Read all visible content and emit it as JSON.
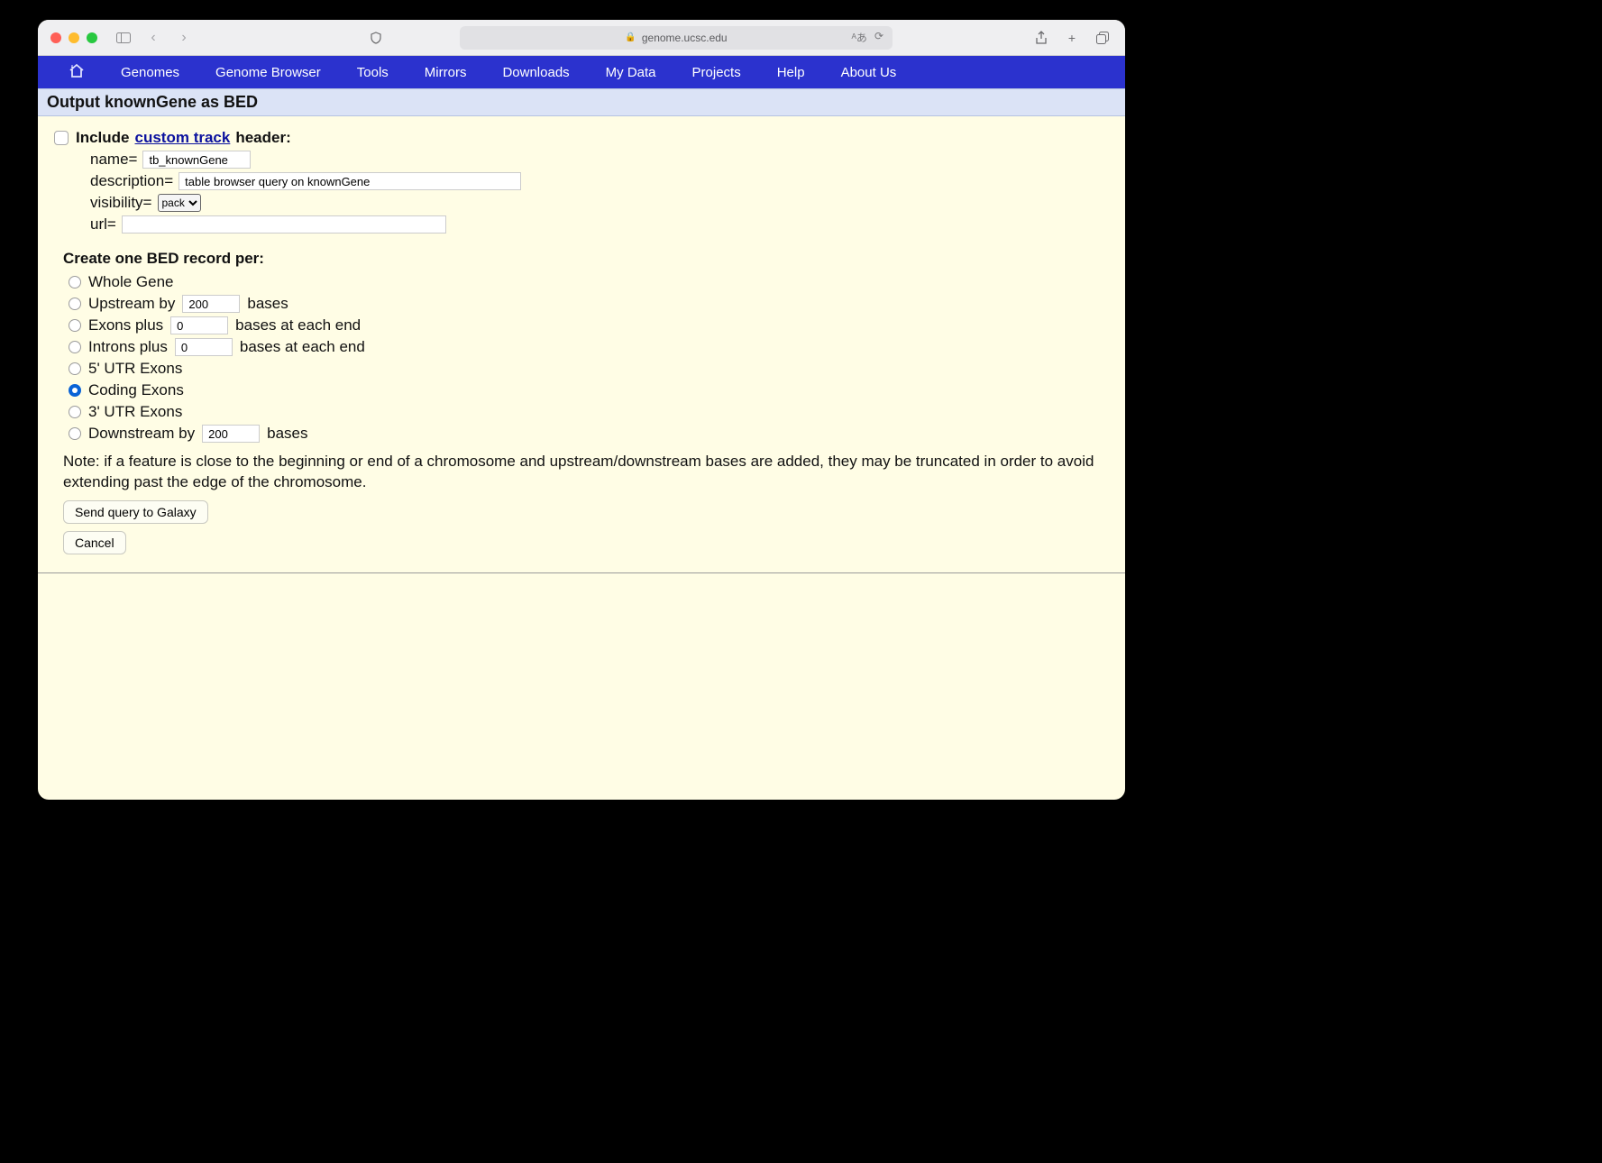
{
  "browser": {
    "address": "genome.ucsc.edu"
  },
  "menubar": {
    "items": [
      "Genomes",
      "Genome Browser",
      "Tools",
      "Mirrors",
      "Downloads",
      "My Data",
      "Projects",
      "Help",
      "About Us"
    ]
  },
  "section_title": "Output knownGene as BED",
  "include": {
    "label_prefix": "Include ",
    "link_text": "custom track",
    "label_suffix": " header:",
    "checked": false
  },
  "fields": {
    "name_label": "name=",
    "name_value": "tb_knownGene",
    "description_label": "description=",
    "description_value": "table browser query on knownGene",
    "visibility_label": "visibility=",
    "visibility_value": "pack",
    "url_label": "url=",
    "url_value": ""
  },
  "create_label": "Create one BED record per:",
  "options": [
    {
      "label": "Whole Gene",
      "checked": false,
      "input": null,
      "suffix": null
    },
    {
      "label": "Upstream by",
      "checked": false,
      "input": "200",
      "suffix": "bases"
    },
    {
      "label": "Exons plus",
      "checked": false,
      "input": "0",
      "suffix": "bases at each end"
    },
    {
      "label": "Introns plus",
      "checked": false,
      "input": "0",
      "suffix": "bases at each end"
    },
    {
      "label": "5' UTR Exons",
      "checked": false,
      "input": null,
      "suffix": null
    },
    {
      "label": "Coding Exons",
      "checked": true,
      "input": null,
      "suffix": null
    },
    {
      "label": "3' UTR Exons",
      "checked": false,
      "input": null,
      "suffix": null
    },
    {
      "label": "Downstream by",
      "checked": false,
      "input": "200",
      "suffix": "bases"
    }
  ],
  "note": "Note: if a feature is close to the beginning or end of a chromosome and upstream/downstream bases are added, they may be truncated in order to avoid extending past the edge of the chromosome.",
  "buttons": {
    "submit": "Send query to Galaxy",
    "cancel": "Cancel"
  }
}
